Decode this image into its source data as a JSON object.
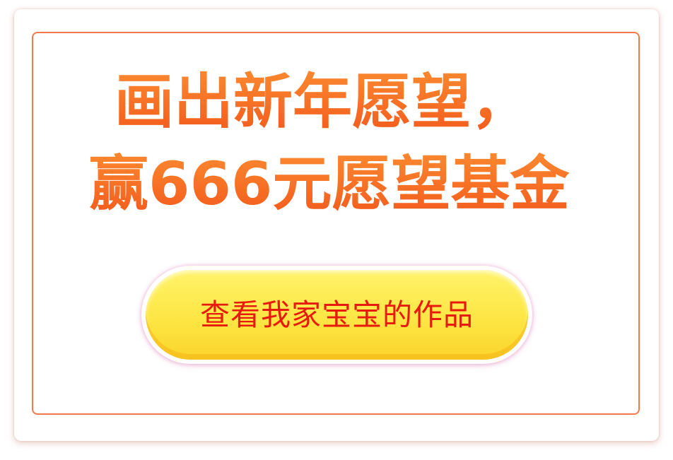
{
  "promo": {
    "headline_line1": "画出新年愿望，",
    "headline_line2": "赢666元愿望基金",
    "cta_label": "查看我家宝宝的作品"
  },
  "colors": {
    "accent_orange": "#f35a1c",
    "border_orange": "#f07a4c",
    "button_yellow": "#fde644",
    "button_text_red": "#e61a0e"
  }
}
